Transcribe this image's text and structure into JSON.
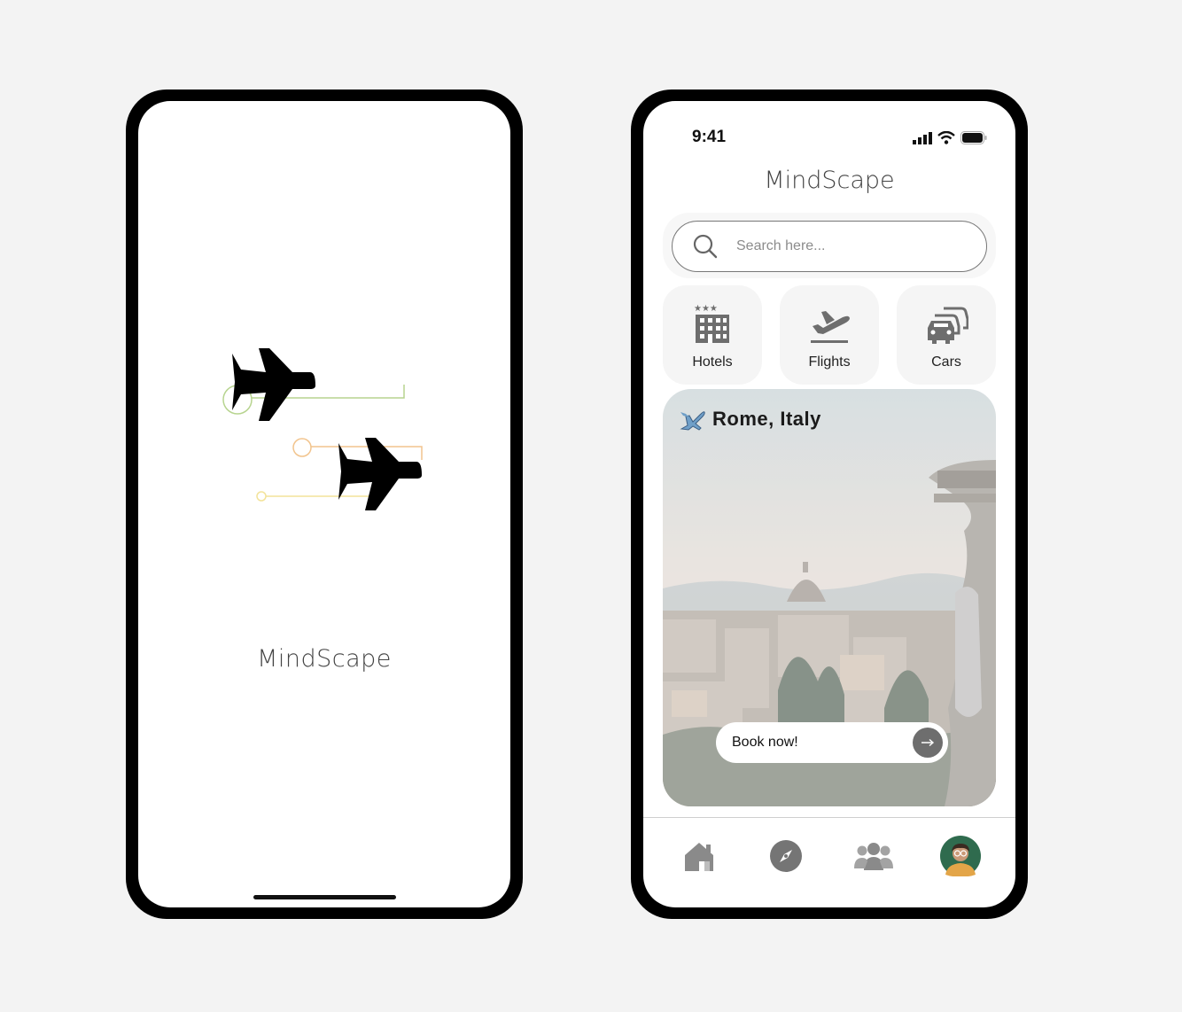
{
  "splash": {
    "brand": "MindScape",
    "icons": [
      "airplane-icon",
      "airplane-icon"
    ]
  },
  "home": {
    "status_time": "9:41",
    "brand": "MindScape",
    "search": {
      "placeholder": "Search here..."
    },
    "categories": [
      {
        "label": "Hotels",
        "icon": "hotel-icon"
      },
      {
        "label": "Flights",
        "icon": "flight-takeoff-icon"
      },
      {
        "label": "Cars",
        "icon": "cars-icon"
      }
    ],
    "featured": {
      "title": "Rome, Italy",
      "icon": "airplane-emoji-icon",
      "button_label": "Book now!"
    },
    "tabs": [
      "home-icon",
      "compass-icon",
      "group-icon",
      "avatar"
    ]
  },
  "colors": {
    "background": "#f3f3f3",
    "frame": "#000000",
    "accent_green": "#b7d48f",
    "accent_orange": "#f2c48d",
    "accent_yellow": "#f3e39a",
    "icon_gray": "#6e6e6e"
  }
}
